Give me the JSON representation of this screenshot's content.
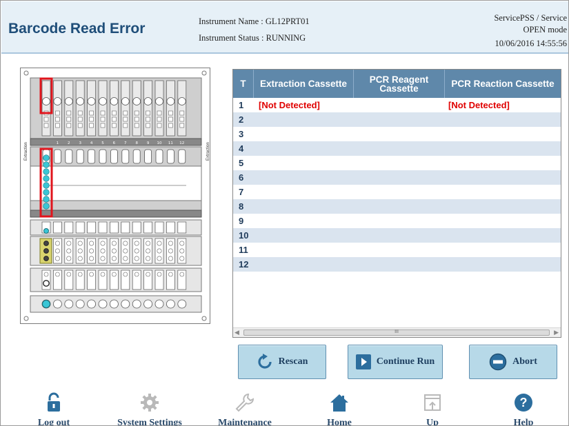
{
  "header": {
    "title": "Barcode Read Error",
    "instrument_name": "Instrument Name : GL12PRT01",
    "instrument_status": "Instrument Status : RUNNING",
    "user": "ServicePSS / Service",
    "mode": "OPEN mode",
    "datetime": "10/06/2016 14:55:56"
  },
  "table": {
    "columns": [
      "T",
      "Extraction Cassette",
      "PCR Reagent Cassette",
      "PCR Reaction Cassette"
    ],
    "rows": [
      {
        "t": "1",
        "extraction": "[Not Detected]",
        "reagent": "",
        "reaction": "[Not Detected]"
      },
      {
        "t": "2",
        "extraction": "",
        "reagent": "",
        "reaction": ""
      },
      {
        "t": "3",
        "extraction": "",
        "reagent": "",
        "reaction": ""
      },
      {
        "t": "4",
        "extraction": "",
        "reagent": "",
        "reaction": ""
      },
      {
        "t": "5",
        "extraction": "",
        "reagent": "",
        "reaction": ""
      },
      {
        "t": "6",
        "extraction": "",
        "reagent": "",
        "reaction": ""
      },
      {
        "t": "7",
        "extraction": "",
        "reagent": "",
        "reaction": ""
      },
      {
        "t": "8",
        "extraction": "",
        "reagent": "",
        "reaction": ""
      },
      {
        "t": "9",
        "extraction": "",
        "reagent": "",
        "reaction": ""
      },
      {
        "t": "10",
        "extraction": "",
        "reagent": "",
        "reaction": ""
      },
      {
        "t": "11",
        "extraction": "",
        "reagent": "",
        "reaction": ""
      },
      {
        "t": "12",
        "extraction": "",
        "reagent": "",
        "reaction": ""
      }
    ],
    "scrollbar_grip": "III"
  },
  "instrument_diagram": {
    "extraction_side_label": "Extraction",
    "lane_numbers": [
      "1",
      "2",
      "3",
      "4",
      "5",
      "6",
      "7",
      "8",
      "9",
      "10",
      "11",
      "12"
    ],
    "highlight_color": "#e0141c",
    "fill_color": "#3ac6d6"
  },
  "actions": {
    "rescan": "Rescan",
    "continue_run": "Continue Run",
    "abort": "Abort"
  },
  "footer": {
    "logout": "Log out",
    "system_settings": "System Settings",
    "maintenance": "Maintenance",
    "home": "Home",
    "up": "Up",
    "help": "Help"
  },
  "colors": {
    "accent": "#1f4e79",
    "header_bg": "#e6f0f7",
    "table_header": "#5f88aa",
    "row_alt": "#dae4ef",
    "error_text": "#e00000",
    "button_bg": "#b7d9e8"
  }
}
